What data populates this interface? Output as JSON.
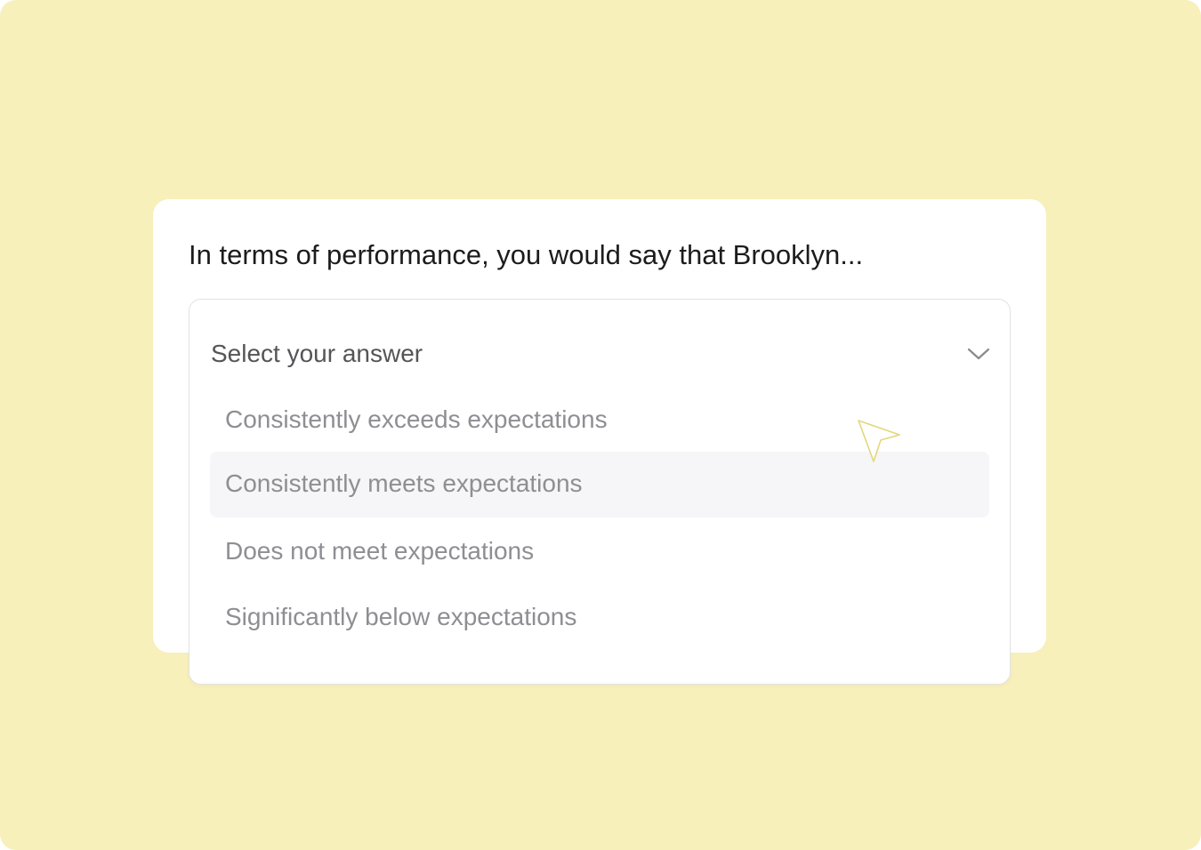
{
  "question": {
    "text": "In terms of performance, you would say that Brooklyn..."
  },
  "dropdown": {
    "placeholder": "Select your answer",
    "toggle_icon": "chevron-down-icon",
    "options": [
      {
        "label": "Consistently exceeds expectations",
        "highlighted": false
      },
      {
        "label": "Consistently meets expectations",
        "highlighted": true
      },
      {
        "label": "Does not meet expectations",
        "highlighted": false
      },
      {
        "label": "Significantly below expectations",
        "highlighted": false
      }
    ]
  },
  "cursor": {
    "icon": "cursor-arrow-icon"
  },
  "colors": {
    "background": "#f7f0ba",
    "card": "#ffffff",
    "question_text": "#1c1c1e",
    "placeholder_text": "#555558",
    "option_text": "#8e8e93",
    "highlight": "#f6f6f8",
    "cursor_stroke": "#e3d77a"
  }
}
